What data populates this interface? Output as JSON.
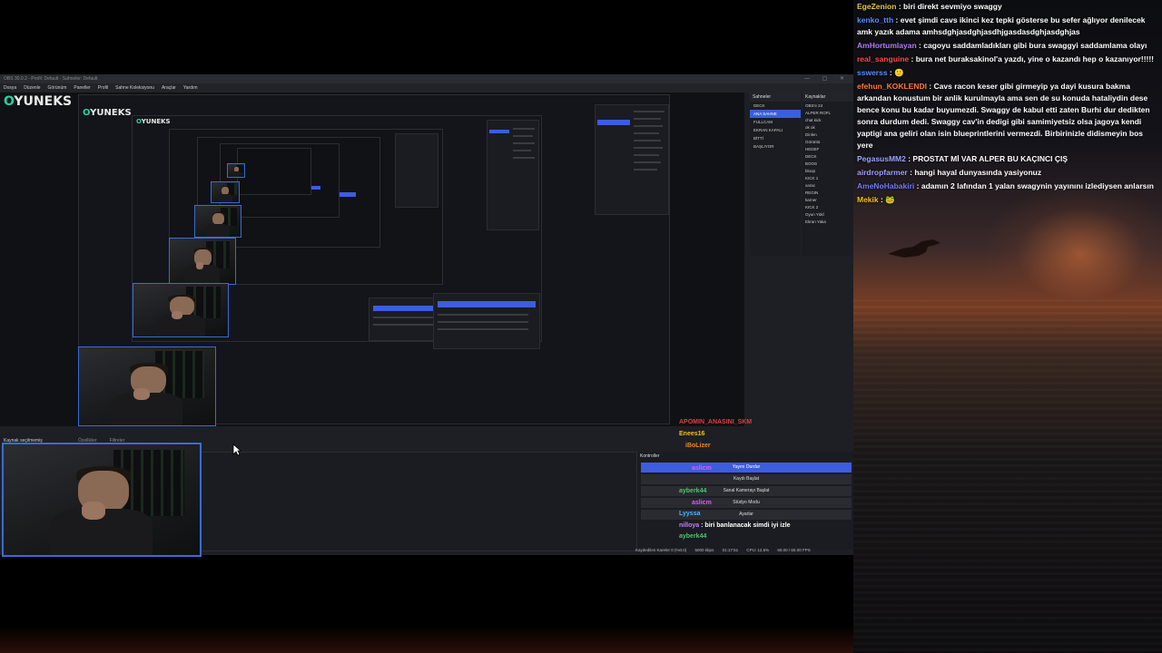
{
  "obs": {
    "title": "OBS 30.0.2 - Profil: Default - Sahneler: Default",
    "win_controls": "— ▢ ✕",
    "menu": [
      "Dosya",
      "Düzenle",
      "Görünüm",
      "Paneller",
      "Profil",
      "Sahne Koleksiyonu",
      "Araçlar",
      "Yardım"
    ],
    "logo_prefix": "O",
    "logo_text": "YUNEKS",
    "scenes_header": "Sahneler",
    "sources_header": "Kaynaklar",
    "scenes": [
      "DECK",
      "ANA SAHNE",
      "FULLCAM",
      "EKRAN KAPALI",
      "BİTTİ",
      "BAŞLIYOR"
    ],
    "sources": [
      "OBS'e 24",
      "ALPER ROFL",
      "chat kick",
      "ok ok",
      "Dinlen",
      "Görüntü",
      "HEDEF",
      "DECK",
      "BOOS",
      "bloop",
      "KICK 1",
      "xarac",
      "REGIN",
      "karner",
      "KICK 2",
      "Oyun Yükl",
      "Ekran Yaka"
    ],
    "cam_label": "Kaynak seçilmemiş",
    "tabs": [
      "Özellikler",
      "Filtreler"
    ],
    "controls_header": "Kontroller",
    "controls": [
      "Yayını Durdur",
      "Kaydı Başlat",
      "Sanal Kamerayı Başlat",
      "Stüdyo Modu",
      "Ayarlar"
    ],
    "status": [
      "Kaydedilen Kareler 0 (%0.0)",
      "5000 kbps",
      "01:17:51",
      "CPU: 12.5%",
      "60.00 / 60.00 FPS"
    ]
  },
  "overlay_chat": [
    {
      "user": "APOMIN_ANASINI_SKM",
      "text": "",
      "color": "#e23c3c"
    },
    {
      "user": "Enees16",
      "text": "",
      "color": "#f0c020"
    },
    {
      "user": "iBoLizer",
      "text": "",
      "color": "#e88a2a"
    },
    {
      "user": "aslicm",
      "text": "",
      "color": "#d65cff"
    },
    {
      "user": "ayberk44",
      "text": "",
      "color": "#4ec26f"
    },
    {
      "user": "aslicm",
      "text": "",
      "color": "#d65cff"
    },
    {
      "user": "Lyyssa",
      "text": "",
      "color": "#44b6ff"
    },
    {
      "user": "nilloya",
      "text": "biri banlanacak simdi iyi izle",
      "color": "#c77dff"
    },
    {
      "user": "ayberk44",
      "text": "",
      "color": "#4ec26f"
    }
  ],
  "chat": [
    {
      "user": "EgeZenion",
      "text": "biri direkt sevmiyo swaggy",
      "color": "#e8c64a"
    },
    {
      "user": "kenko_tth",
      "text": "evet şimdi cavs ikinci kez tepki gösterse bu sefer ağlıyor denilecek amk yazık adama amhsdghjasdghjasdhjgasdasdghjasdghjas",
      "color": "#5b8cff"
    },
    {
      "user": "AmHortumlayan",
      "text": "cagoyu saddamladıkları gibi bura swaggyi saddamlama olayı",
      "color": "#b27cff"
    },
    {
      "user": "real_sanguine",
      "text": "bura net buraksakinol'a yazdı, yine o kazandı hep o kazanıyor!!!!!",
      "color": "#ff4a4a"
    },
    {
      "user": "sswerss",
      "text": "🙂",
      "color": "#5b8cff"
    },
    {
      "user": "efehun_KOKLENDI",
      "text": "Cavs racon keser gibi girmeyip ya dayi kusura bakma arkandan konustum bir anlik kurulmayla ama sen de su konuda hataliydin dese bence konu bu kadar buyumezdi. Swaggy de kabul etti zaten Burhi dur dedikten sonra durdum dedi. Swaggy cav'in dedigi gibi samimiyetsiz olsa jagoya kendi yaptigi ana geliri olan isin blueprintlerini vermezdi. Birbirinizle didismeyin bos yere",
      "color": "#ff7a3c"
    },
    {
      "user": "PegasusMM2",
      "text": "PROSTAT Mİ VAR ALPER BU KAÇINCI ÇIŞ",
      "color": "#9aa3ff"
    },
    {
      "user": "airdropfarmer",
      "text": "hangi hayal dunyasında yasiyonuz",
      "color": "#a0a0ff"
    },
    {
      "user": "AmeNoHabakiri",
      "text": "adamın 2 lafından 1 yalan swagynin yayınını izlediysen anlarsın",
      "color": "#6f7bff"
    },
    {
      "user": "Mekik",
      "text": "🐸",
      "color": "#f0c020"
    }
  ]
}
